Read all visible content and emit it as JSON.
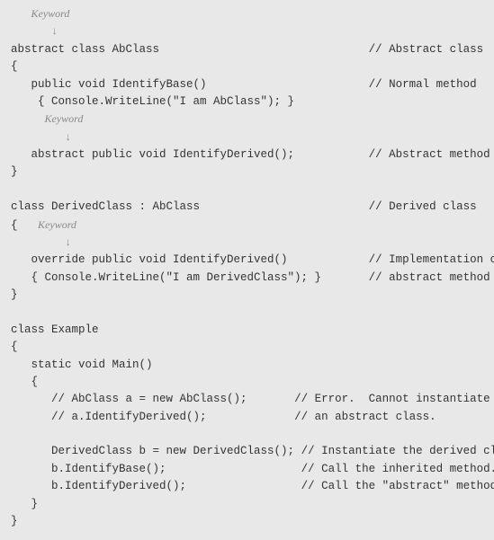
{
  "annotations": {
    "keyword": "Keyword",
    "arrow": "↓"
  },
  "code": {
    "l1": "abstract class AbClass",
    "c1": "// Abstract class",
    "l2": "{",
    "l3": "   public void IdentifyBase()",
    "c3": "// Normal method",
    "l4": "    { Console.WriteLine(\"I am AbClass\"); }",
    "l5": "   abstract public void IdentifyDerived();",
    "c5": "// Abstract method",
    "l6": "}",
    "l7": "class DerivedClass : AbClass",
    "c7": "// Derived class",
    "l8": "{",
    "l9": "   override public void IdentifyDerived()",
    "c9": "// Implementation of",
    "l10": "   { Console.WriteLine(\"I am DerivedClass\"); }",
    "c10": "// abstract method",
    "l11": "}",
    "l12": "class Example",
    "l13": "{",
    "l14": "   static void Main()",
    "l15": "   {",
    "l16": "      // AbClass a = new AbClass();",
    "c16": "// Error.  Cannot instantiate",
    "l17": "      // a.IdentifyDerived();",
    "c17": "// an abstract class.",
    "l18": "      DerivedClass b = new DerivedClass();",
    "c18": "// Instantiate the derived class.",
    "l19": "      b.IdentifyBase();",
    "c19": "// Call the inherited method.",
    "l20": "      b.IdentifyDerived();",
    "c20": "// Call the \"abstract\" method.",
    "l21": "   }",
    "l22": "}"
  }
}
